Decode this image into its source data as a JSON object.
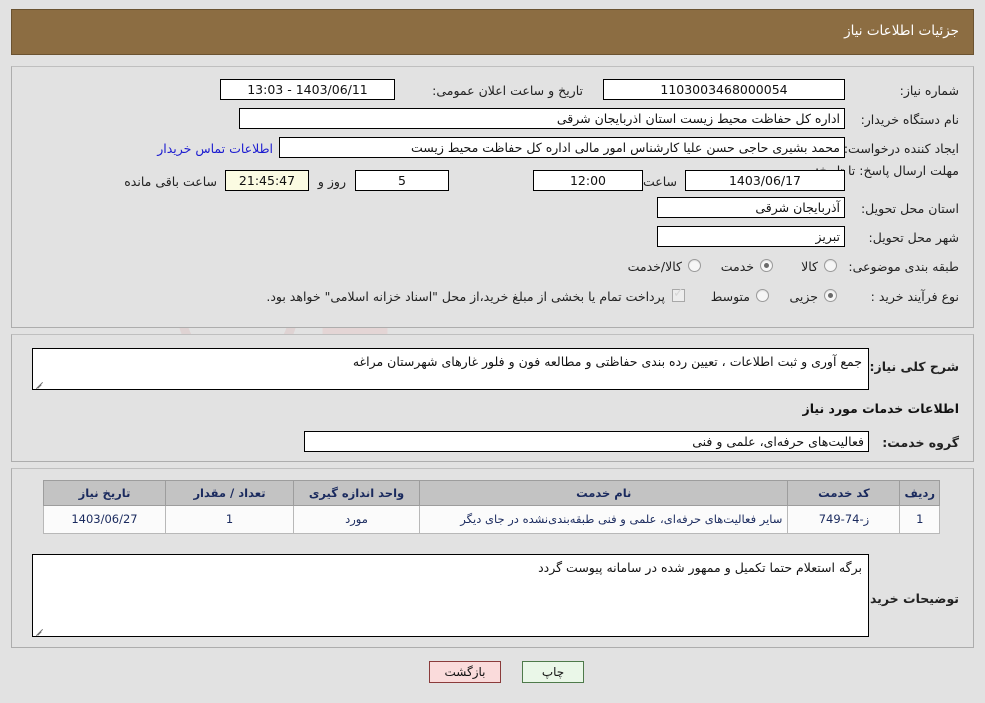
{
  "header": {
    "title": "جزئیات اطلاعات نیاز"
  },
  "watermark": {
    "text_main": "AriaTender",
    "text_tld": ".net"
  },
  "top_panel": {
    "labels": {
      "need_number": "شماره نیاز:",
      "buyer_org": "نام دستگاه خریدار:",
      "request_creator": "ایجاد کننده درخواست:",
      "response_deadline": "مهلت ارسال پاسخ: تا تاریخ:",
      "delivery_province": "استان محل تحویل:",
      "delivery_city": "شهر محل تحویل:",
      "subject_classification": "طبقه بندی موضوعی:",
      "purchase_process_type": "نوع فرآیند خرید :",
      "public_announce_datetime": "تاریخ و ساعت اعلان عمومی:",
      "hour": "ساعت",
      "days_and": "روز و",
      "hours_remaining": "ساعت باقی مانده"
    },
    "values": {
      "need_number": "1103003468000054",
      "public_announce_datetime": "1403/06/11 - 13:03",
      "buyer_org": "اداره کل حفاظت محیط زیست استان اذربایجان شرقی",
      "request_creator": "محمد بشیری حاجی حسن علیا کارشناس امور مالی اداره کل حفاظت محیط زیست",
      "buyer_contact_link": "اطلاعات تماس خریدار",
      "deadline_date": "1403/06/17",
      "deadline_time": "12:00",
      "days_left": "5",
      "time_left": "21:45:47",
      "delivery_province": "آذربایجان شرقی",
      "delivery_city": "تبریز"
    },
    "classification_options": [
      {
        "label": "کالا",
        "selected": false
      },
      {
        "label": "خدمت",
        "selected": true
      },
      {
        "label": "کالا/خدمت",
        "selected": false
      }
    ],
    "process_options": [
      {
        "label": "جزیی",
        "selected": true
      },
      {
        "label": "متوسط",
        "selected": false
      }
    ],
    "treasury_checkbox": {
      "label": "پرداخت تمام یا بخشی از مبلغ خرید،از محل \"اسناد خزانه اسلامی\" خواهد بود.",
      "checked": true
    }
  },
  "mid_panel": {
    "general_desc_label": "شرح کلی نیاز:",
    "general_desc_value": "جمع آوری و ثبت اطلاعات ، تعیین رده بندی حفاظتی و مطالعه فون و فلور غارهای شهرستان مراغه",
    "services_section_title": "اطلاعات خدمات مورد نیاز",
    "service_group_label": "گروه خدمت:",
    "service_group_value": "فعالیت‌های حرفه‌ای، علمی و فنی"
  },
  "table": {
    "columns": [
      "ردیف",
      "کد خدمت",
      "نام خدمت",
      "واحد اندازه گیری",
      "تعداد / مقدار",
      "تاریخ نیاز"
    ],
    "rows": [
      {
        "row_no": "1",
        "service_code": "ز-74-749",
        "service_name": "سایر فعالیت‌های حرفه‌ای، علمی و فنی طبقه‌بندی‌نشده در جای دیگر",
        "unit": "مورد",
        "quantity": "1",
        "need_date": "1403/06/27"
      }
    ]
  },
  "buyer_notes": {
    "label": "توضیحات خریدار:",
    "value": "برگه استعلام حتما تکمیل و ممهور شده در سامانه پیوست گردد"
  },
  "footer": {
    "print_label": "چاپ",
    "back_label": "بازگشت"
  },
  "colors": {
    "header_bg": "#8c6d42",
    "page_bg": "#e2e2e2",
    "table_header_bg": "#c3c3c3",
    "table_text": "#1a2a5e",
    "link": "#1b1bd0",
    "print_btn_bg": "#eaf7e8",
    "back_btn_bg": "#fadbdb",
    "timer_bg": "#fbfbe2"
  }
}
